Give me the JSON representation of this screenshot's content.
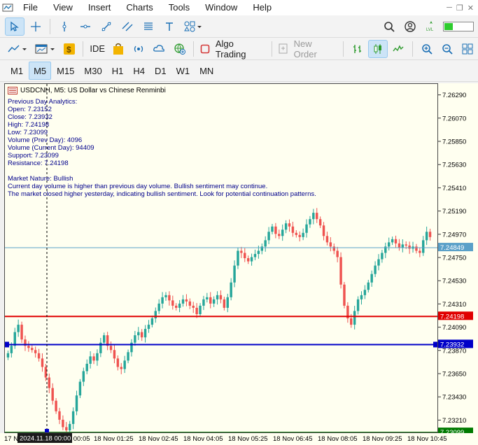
{
  "menu": [
    "File",
    "View",
    "Insert",
    "Charts",
    "Tools",
    "Window",
    "Help"
  ],
  "toolbar2": {
    "algo_trading": "Algo Trading",
    "new_order": "New Order",
    "ide": "IDE"
  },
  "timeframes": [
    "M1",
    "M5",
    "M15",
    "M30",
    "H1",
    "H4",
    "D1",
    "W1",
    "MN"
  ],
  "active_timeframe": "M5",
  "chart": {
    "title": "USDCNH, M5:  US Dollar vs Chinese Renminbi",
    "analytics": [
      "Previous Day Analytics:",
      "Open: 7.23152",
      "Close: 7.23932",
      "High: 7.24198",
      "Low: 7.23099",
      "Volume (Prev Day): 4096",
      "Volume (Current Day): 94409",
      "Support: 7.23099",
      "Resistance: 7.24198",
      "",
      "Market Nature: Bullish",
      "Current day volume is higher than previous day volume. Bullish sentiment may continue.",
      "The market closed higher yesterday, indicating bullish sentiment. Look for potential continuation patterns."
    ],
    "cursor_time": "2024.11.18 00:00"
  },
  "chart_data": {
    "type": "candlestick",
    "symbol": "USDCNH",
    "timeframe": "M5",
    "y_ticks": [
      7.2629,
      7.2607,
      7.2585,
      7.2563,
      7.2541,
      7.2519,
      7.2497,
      7.2475,
      7.2453,
      7.2431,
      7.2409,
      7.2387,
      7.2365,
      7.2343,
      7.2321
    ],
    "y_tick_labels": [
      "7.26290",
      "7.26070",
      "7.25850",
      "7.25630",
      "7.25410",
      "7.25190",
      "7.24970",
      "7.24750",
      "7.24530",
      "7.24310",
      "7.24090",
      "7.23870",
      "7.23650",
      "7.23430",
      "7.23210"
    ],
    "ylim": [
      7.231,
      7.264
    ],
    "x_labels": [
      "17 N",
      "18 Nov 00:05",
      "18 Nov 01:25",
      "18 Nov 02:45",
      "18 Nov 04:05",
      "18 Nov 05:25",
      "18 Nov 06:45",
      "18 Nov 08:05",
      "18 Nov 09:25",
      "18 Nov 10:45"
    ],
    "levels": [
      {
        "name": "current-price",
        "value": 7.24849,
        "label": "7.24849",
        "color": "#5aa0c8"
      },
      {
        "name": "resistance",
        "value": 7.24198,
        "label": "7.24198",
        "color": "#e00000"
      },
      {
        "name": "close",
        "value": 7.23932,
        "label": "7.23932",
        "color": "#0000c8"
      },
      {
        "name": "support",
        "value": 7.23099,
        "label": "7.23099",
        "color": "#007a00"
      }
    ],
    "close_series": [
      7.2385,
      7.2392,
      7.2405,
      7.2412,
      7.2398,
      7.2392,
      7.239,
      7.2388,
      7.2385,
      7.238,
      7.2372,
      7.2362,
      7.2352,
      7.234,
      7.233,
      7.2322,
      7.2315,
      7.2312,
      7.2318,
      7.233,
      7.2345,
      7.2358,
      7.2368,
      7.2375,
      7.2382,
      7.2378,
      7.2385,
      7.2395,
      7.2402,
      7.2392,
      7.2388,
      7.238,
      7.2372,
      7.237,
      7.2378,
      7.2386,
      7.2395,
      7.2402,
      7.2405,
      7.24,
      7.2408,
      7.2412,
      7.2418,
      7.2425,
      7.2432,
      7.2438,
      7.244,
      7.2435,
      7.243,
      7.2428,
      7.2432,
      7.2436,
      7.2434,
      7.243,
      7.2428,
      7.2422,
      7.243,
      7.2436,
      7.2438,
      7.2432,
      7.2436,
      7.244,
      7.2436,
      7.2428,
      7.2438,
      7.2452,
      7.2468,
      7.2482,
      7.248,
      7.2475,
      7.2472,
      7.2476,
      7.2479,
      7.2482,
      7.2486,
      7.2492,
      7.25,
      7.2505,
      7.2498,
      7.2496,
      7.2502,
      7.2508,
      7.2505,
      7.2499,
      7.2497,
      7.2495,
      7.2499,
      7.2507,
      7.2512,
      7.2518,
      7.2512,
      7.2506,
      7.2496,
      7.249,
      7.2486,
      7.2482,
      7.2476,
      7.245,
      7.243,
      7.2418,
      7.2412,
      7.2425,
      7.2436,
      7.244,
      7.2445,
      7.2452,
      7.246,
      7.2468,
      7.2474,
      7.248,
      7.2486,
      7.249,
      7.2493,
      7.2489,
      7.2485,
      7.2488,
      7.2487,
      7.2484,
      7.2486,
      7.2482,
      7.248,
      7.2492,
      7.25,
      7.2495
    ]
  }
}
